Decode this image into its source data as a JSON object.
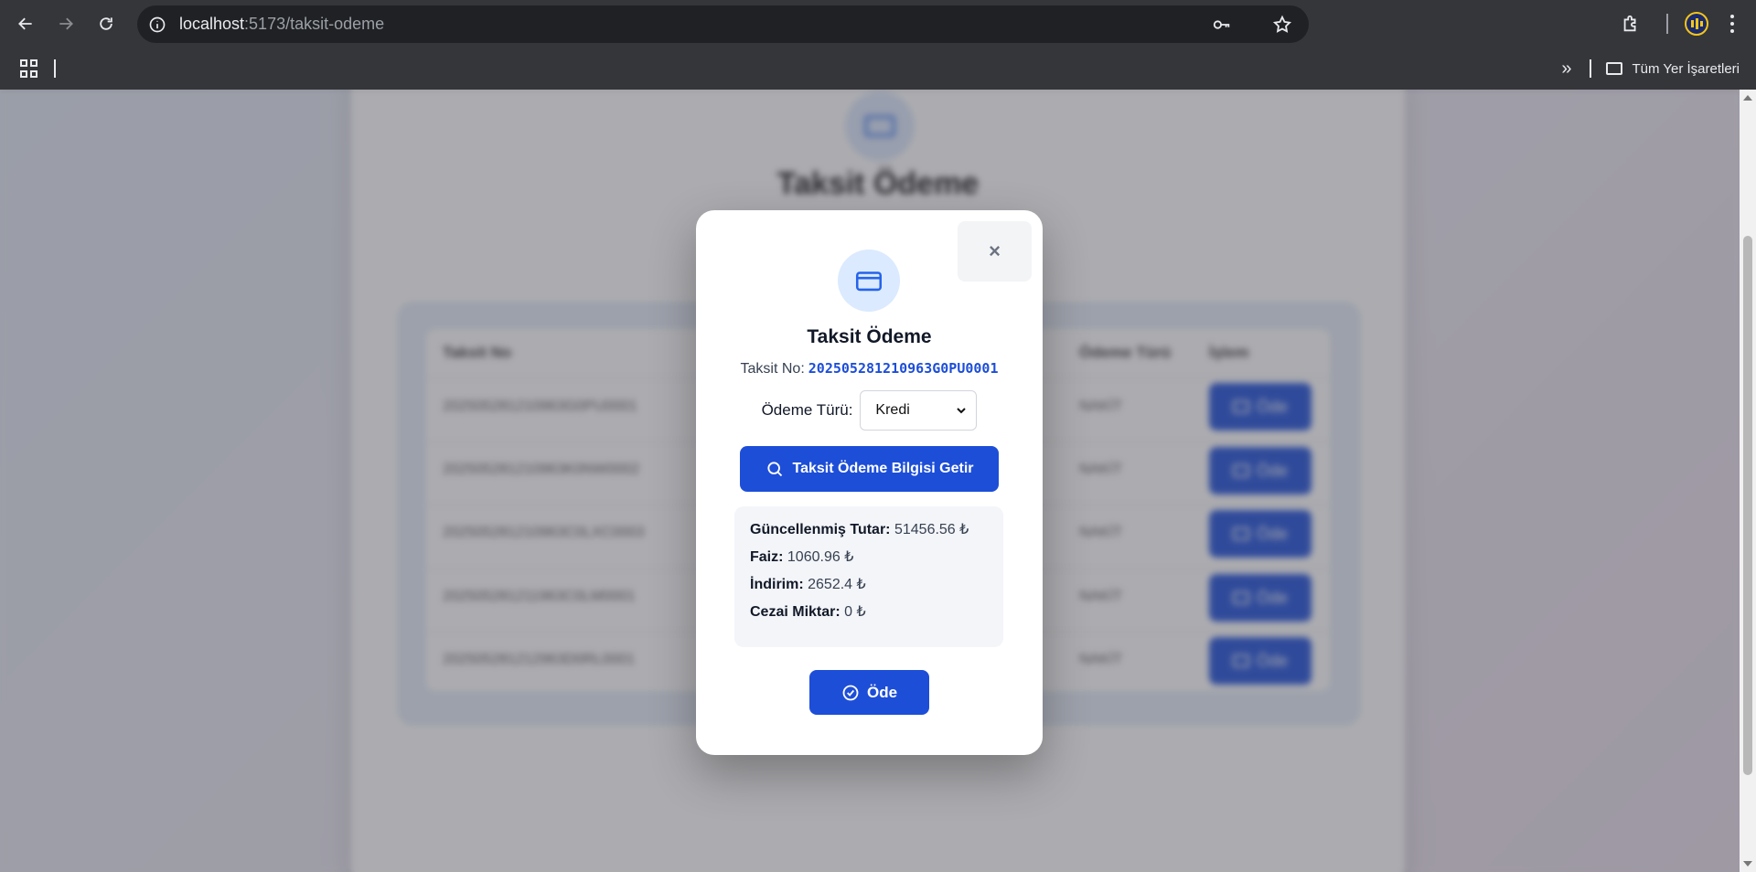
{
  "browser": {
    "url_host": "localhost",
    "url_path": ":5173/taksit-odeme",
    "bookmarks_all_label": "Tüm Yer İşaretleri",
    "bookmarks_overflow": "»"
  },
  "background": {
    "title": "Taksit Ödeme",
    "table": {
      "headers": [
        "Taksit No",
        "Ödeme Türü",
        "İşlem"
      ],
      "rows": [
        {
          "no": "202505281210963G0PU0001",
          "tur": "NAKİT",
          "action": "Öde"
        },
        {
          "no": "202505281210963K0NW0002",
          "tur": "NAKİT",
          "action": "Öde"
        },
        {
          "no": "202505281210963C0LXC0003",
          "tur": "NAKİT",
          "action": "Öde"
        },
        {
          "no": "202505281211963C0LM0001",
          "tur": "NAKİT",
          "action": "Öde"
        },
        {
          "no": "202505281212963D0RL0001",
          "tur": "NAKİT",
          "action": "Öde"
        }
      ]
    }
  },
  "modal": {
    "close_label": "×",
    "title": "Taksit Ödeme",
    "taksit_no_label": "Taksit No:",
    "taksit_no_value": "202505281210963G0PU0001",
    "odeme_turu_label": "Ödeme Türü:",
    "odeme_turu_value": "Kredi",
    "fetch_button": "Taksit Ödeme Bilgisi Getir",
    "info": {
      "guncel_label": "Güncellenmiş Tutar:",
      "guncel_value": "51456.56 ₺",
      "faiz_label": "Faiz:",
      "faiz_value": "1060.96 ₺",
      "indirim_label": "İndirim:",
      "indirim_value": "2652.4 ₺",
      "ceza_label": "Cezai Miktar:",
      "ceza_value": "0 ₺"
    },
    "pay_button": "Öde"
  },
  "colors": {
    "primary": "#1d4ed8",
    "icon_bg": "#dbeafe"
  }
}
